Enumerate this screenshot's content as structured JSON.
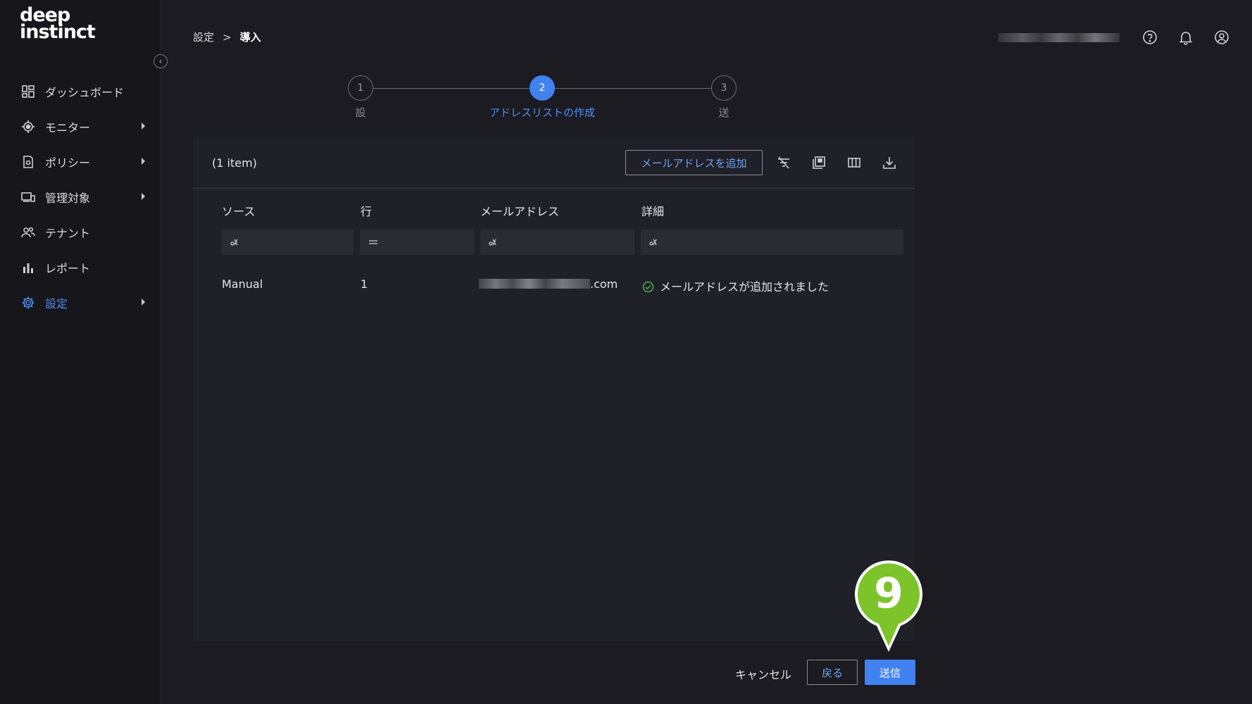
{
  "logo": {
    "line1": "deep",
    "line2": "instinct"
  },
  "sidebar": {
    "items": [
      {
        "label": "ダッシュボード",
        "icon": "dashboard-icon",
        "has_submenu": false,
        "active": false
      },
      {
        "label": "モニター",
        "icon": "monitor-icon",
        "has_submenu": true,
        "active": false
      },
      {
        "label": "ポリシー",
        "icon": "policy-icon",
        "has_submenu": true,
        "active": false
      },
      {
        "label": "管理対象",
        "icon": "devices-icon",
        "has_submenu": true,
        "active": false
      },
      {
        "label": "テナント",
        "icon": "tenants-icon",
        "has_submenu": false,
        "active": false
      },
      {
        "label": "レポート",
        "icon": "reports-icon",
        "has_submenu": false,
        "active": false
      },
      {
        "label": "設定",
        "icon": "gear-icon",
        "has_submenu": true,
        "active": true
      }
    ]
  },
  "breadcrumb": {
    "parent": "設定",
    "separator": ">",
    "current": "導入"
  },
  "stepper": {
    "steps": [
      {
        "number": "1",
        "label": "設",
        "active": false
      },
      {
        "number": "2",
        "label": "アドレスリストの作成",
        "active": true
      },
      {
        "number": "3",
        "label": "送",
        "active": false
      }
    ]
  },
  "panel": {
    "item_count": "(1 item)",
    "add_button": "メールアドレスを追加",
    "columns": [
      "ソース",
      "行",
      "メールアドレス",
      "詳細"
    ],
    "rows": [
      {
        "source": "Manual",
        "row": "1",
        "email_suffix": ".com",
        "detail": "メールアドレスが追加されました"
      }
    ]
  },
  "footer": {
    "cancel": "キャンセル",
    "back": "戻る",
    "submit": "送信"
  },
  "marker": {
    "number": "9"
  },
  "colors": {
    "accent": "#3f82f0",
    "success": "#4caf50",
    "marker": "#7cc42a"
  }
}
